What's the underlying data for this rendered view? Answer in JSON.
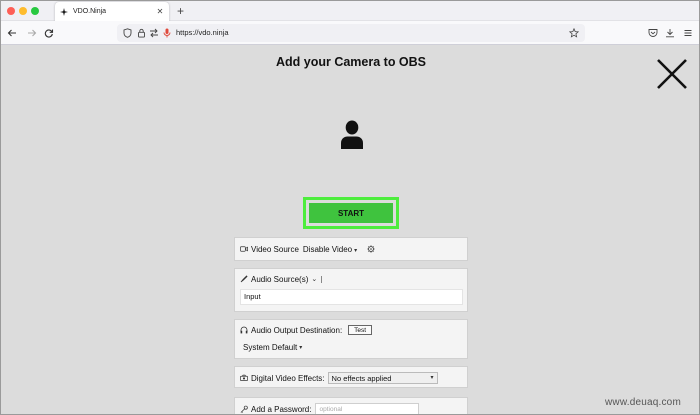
{
  "browser": {
    "tab_title": "VDO.Ninja",
    "tab_close": "✕",
    "new_tab": "+",
    "url": "https://vdo.ninja"
  },
  "page": {
    "title": "Add your Camera to OBS",
    "start_label": "START",
    "start_outline_color": "#4ded3d",
    "start_color": "#3fc33e"
  },
  "video_source": {
    "label": "Video Source",
    "value": "Disable Video"
  },
  "audio_sources": {
    "label": "Audio Source(s)",
    "input_value": "Input"
  },
  "audio_output": {
    "label": "Audio Output Destination:",
    "test_label": "Test",
    "value": "System Default"
  },
  "video_effects": {
    "label": "Digital Video Effects:",
    "value": "No effects applied"
  },
  "password": {
    "label": "Add a Password:",
    "placeholder": "optional"
  },
  "watermark": "www.deuaq.com"
}
